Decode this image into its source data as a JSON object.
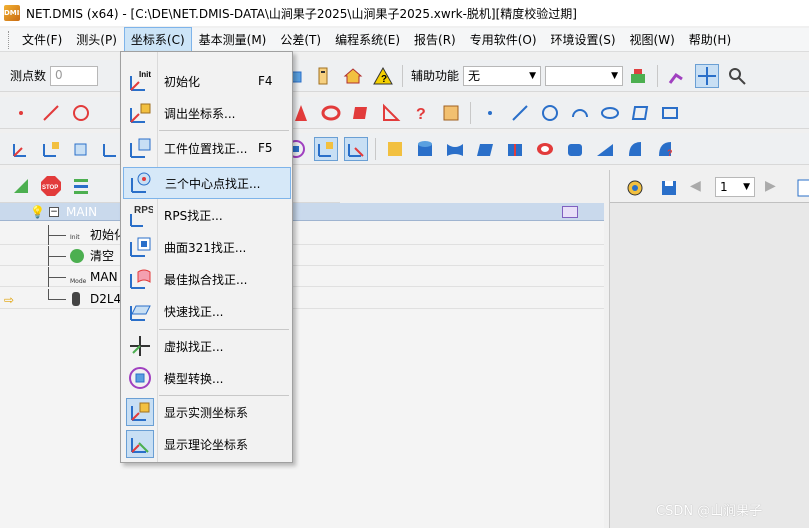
{
  "window": {
    "app_logo_text": "DMIS",
    "title": "NET.DMIS (x64) - [C:\\DE\\NET.DMIS-DATA\\山涧果子2025\\山涧果子2025.xwrk-脱机][精度校验过期]"
  },
  "menubar": {
    "items": [
      "文件(F)",
      "测头(P)",
      "坐标系(C)",
      "基本测量(M)",
      "公差(T)",
      "编程系统(E)",
      "报告(R)",
      "专用软件(O)",
      "环境设置(S)",
      "视图(W)",
      "帮助(H)"
    ],
    "active_index": 2
  },
  "toolbar1": {
    "points_label": "测点数",
    "points_value": "0",
    "aux_label": "辅助功能",
    "aux_value": "无",
    "aux_value2": ""
  },
  "coord_menu": {
    "items": [
      {
        "icon": "init-coord-icon",
        "label": "初始化",
        "shortcut": "F4"
      },
      {
        "icon": "recall-coord-icon",
        "label": "调出坐标系...",
        "shortcut": ""
      },
      {
        "icon": "workpiece-align-icon",
        "label": "工件位置找正...",
        "shortcut": "F5"
      },
      {
        "icon": "three-center-icon",
        "label": "三个中心点找正...",
        "shortcut": ""
      },
      {
        "icon": "rps-icon",
        "label": "RPS找正...",
        "shortcut": ""
      },
      {
        "icon": "surface-321-icon",
        "label": "曲面321找正...",
        "shortcut": ""
      },
      {
        "icon": "best-fit-icon",
        "label": "最佳拟合找正...",
        "shortcut": ""
      },
      {
        "icon": "quick-align-icon",
        "label": "快速找正...",
        "shortcut": ""
      },
      {
        "icon": "virtual-align-icon",
        "label": "虚拟找正...",
        "shortcut": ""
      },
      {
        "icon": "model-transform-icon",
        "label": "模型转换...",
        "shortcut": ""
      },
      {
        "icon": "show-actual-coord-icon",
        "label": "显示实测坐标系",
        "shortcut": ""
      },
      {
        "icon": "show-nominal-coord-icon",
        "label": "显示理论坐标系",
        "shortcut": ""
      }
    ],
    "hover_index": 3,
    "rps_icon_text": "RPS",
    "init_icon_text": "Init"
  },
  "tree": {
    "header": "MAIN",
    "rows": [
      {
        "label": "初始化",
        "icon_text": "Init"
      },
      {
        "label": "清空"
      },
      {
        "label": "MAN",
        "icon_text": "Mode"
      },
      {
        "label": "D2L4"
      }
    ]
  },
  "right_panel": {
    "page_value": "1"
  },
  "watermark": "CSDN @山涧果子",
  "colors": {
    "menu_active_bg": "#cce4f7",
    "menu_hover_border": "#7eb4ea",
    "tree_header_bg": "#c9d9ec",
    "accent_blue": "#2a6fc9",
    "accent_red": "#e23b3b"
  }
}
